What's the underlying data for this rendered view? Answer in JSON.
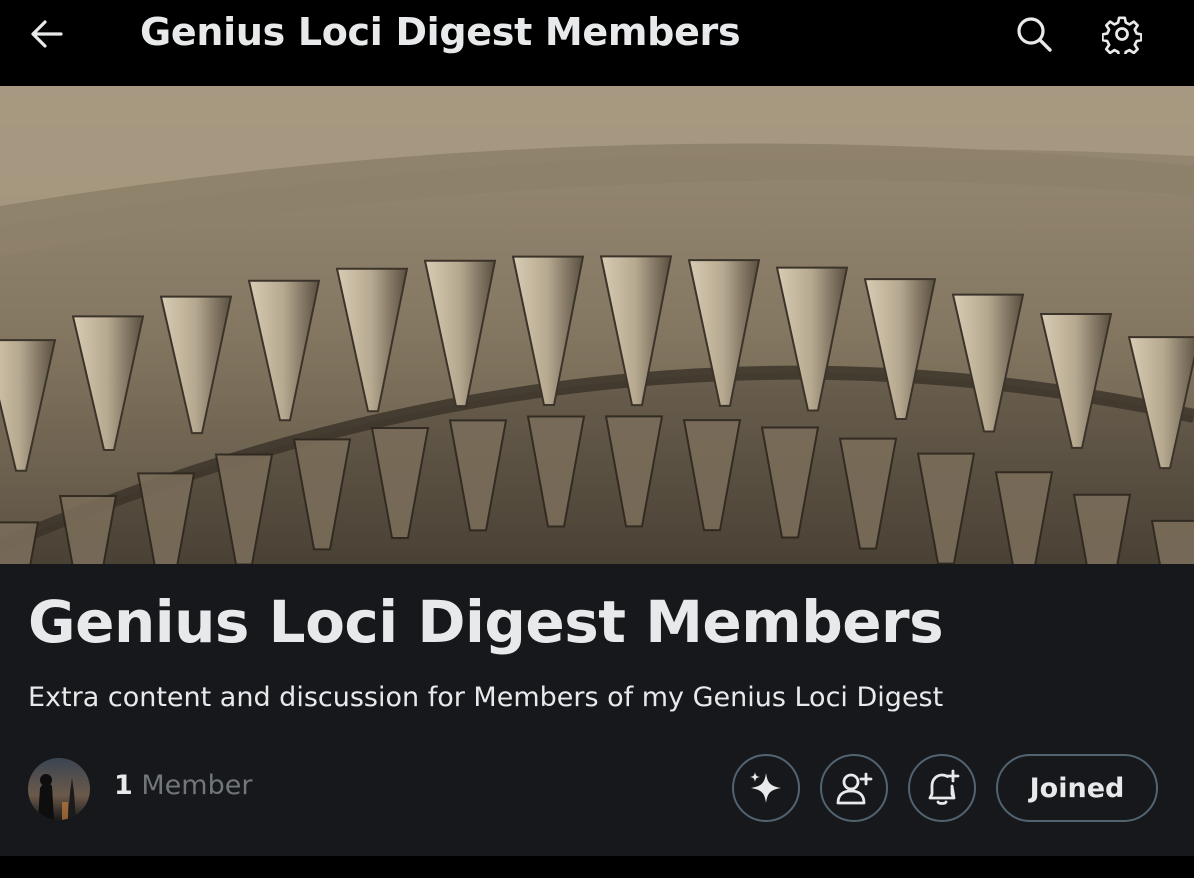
{
  "header": {
    "title": "Genius Loci Digest Members",
    "back_icon": "arrow-left-icon",
    "search_icon": "search-icon",
    "settings_icon": "gear-icon"
  },
  "community": {
    "name": "Genius Loci Digest Members",
    "description": "Extra content and discussion for Members of my Genius Loci Digest",
    "member_count": "1",
    "member_label": "Member"
  },
  "actions": {
    "ai_icon": "sparkle-icon",
    "invite_icon": "add-user-icon",
    "notify_icon": "bell-plus-icon",
    "joined_label": "Joined"
  },
  "colors": {
    "background": "#000000",
    "panel": "#16181c",
    "text_primary": "#e7e9ea",
    "text_secondary": "#71767b",
    "border": "#536471"
  }
}
